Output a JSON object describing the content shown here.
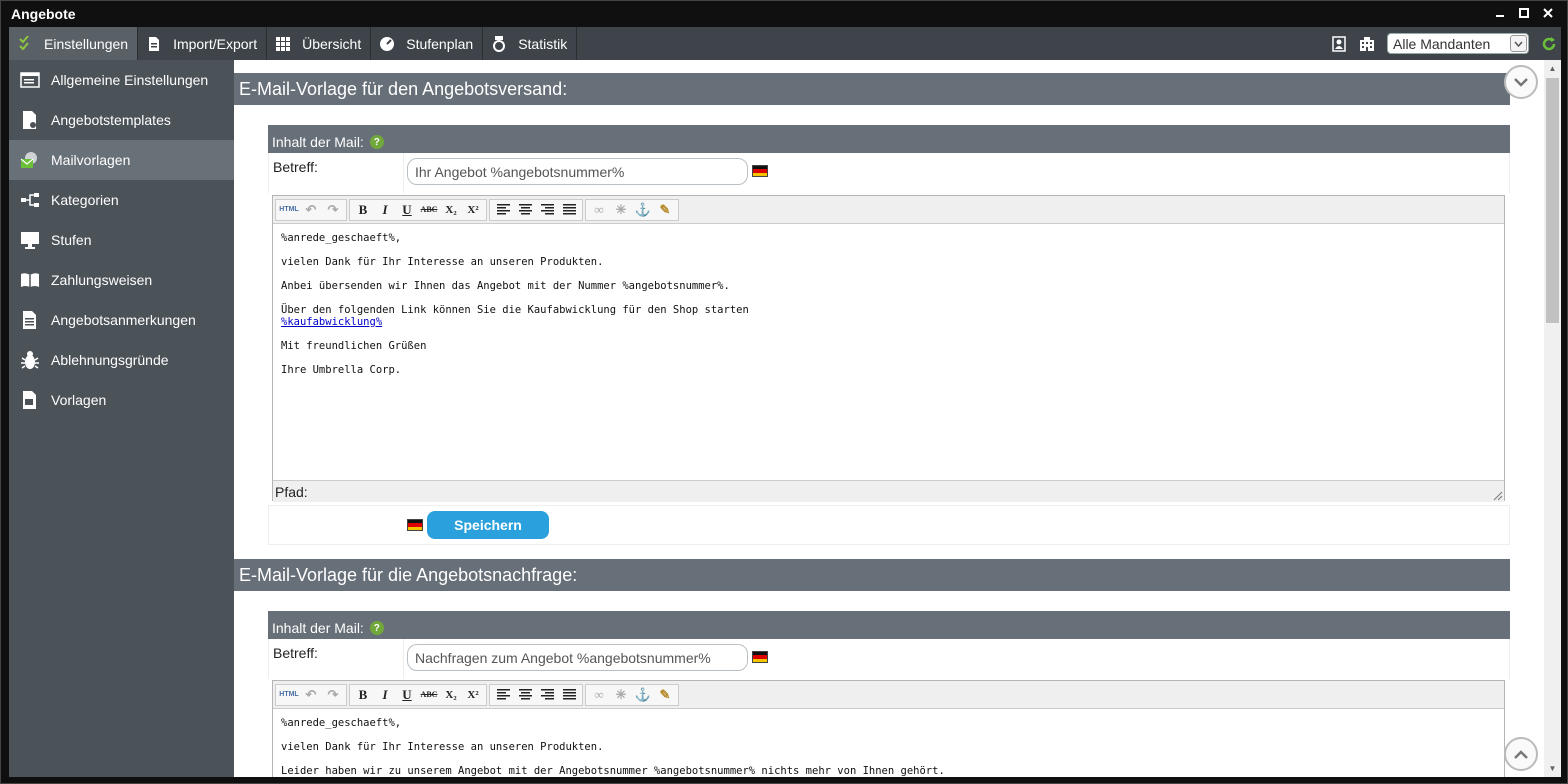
{
  "window": {
    "title": "Angebote"
  },
  "toolbar": {
    "items": [
      {
        "label": "Einstellungen",
        "icon": "checklist-icon"
      },
      {
        "label": "Import/Export",
        "icon": "document-icon"
      },
      {
        "label": "Übersicht",
        "icon": "grid-icon"
      },
      {
        "label": "Stufenplan",
        "icon": "gauge-icon"
      },
      {
        "label": "Statistik",
        "icon": "medal-icon"
      }
    ],
    "mandant_select": {
      "value": "Alle Mandanten"
    }
  },
  "sidebar": {
    "items": [
      {
        "label": "Allgemeine Einstellungen"
      },
      {
        "label": "Angebotstemplates"
      },
      {
        "label": "Mailvorlagen"
      },
      {
        "label": "Kategorien"
      },
      {
        "label": "Stufen"
      },
      {
        "label": "Zahlungsweisen"
      },
      {
        "label": "Angebotsanmerkungen"
      },
      {
        "label": "Ablehnungsgründe"
      },
      {
        "label": "Vorlagen"
      }
    ]
  },
  "sections": [
    {
      "title": "E-Mail-Vorlage für den Angebotsversand:",
      "mail_label": "Inhalt der Mail:",
      "subject_label": "Betreff:",
      "subject": "Ihr Angebot %angebotsnummer%",
      "body": [
        "%anrede_geschaeft%,",
        "vielen Dank für Ihr Interesse an unseren Produkten.",
        "Anbei übersenden wir Ihnen das Angebot mit der Nummer %angebotsnummer%.",
        "Über den folgenden Link können Sie die Kaufabwicklung für den Shop starten",
        "Mit freundlichen Grüßen",
        "Ihre Umbrella Corp."
      ],
      "link": "%kaufabwicklung%",
      "path_label": "Pfad:",
      "save_label": "Speichern"
    },
    {
      "title": "E-Mail-Vorlage für die Angebotsnachfrage:",
      "mail_label": "Inhalt der Mail:",
      "subject_label": "Betreff:",
      "subject": "Nachfragen zum Angebot %angebotsnummer%",
      "body": [
        "%anrede_geschaeft%,",
        "vielen Dank für Ihr Interesse an unseren Produkten.",
        "Leider haben wir zu unserem Angebot mit der Angebotsnummer %angebotsnummer% nichts mehr von Ihnen gehört."
      ]
    }
  ],
  "editor_buttons": {
    "html": "HTML",
    "bold": "B",
    "italic": "I",
    "underline": "U",
    "strike": "ABC",
    "sub": "X₂",
    "sup": "X²"
  }
}
